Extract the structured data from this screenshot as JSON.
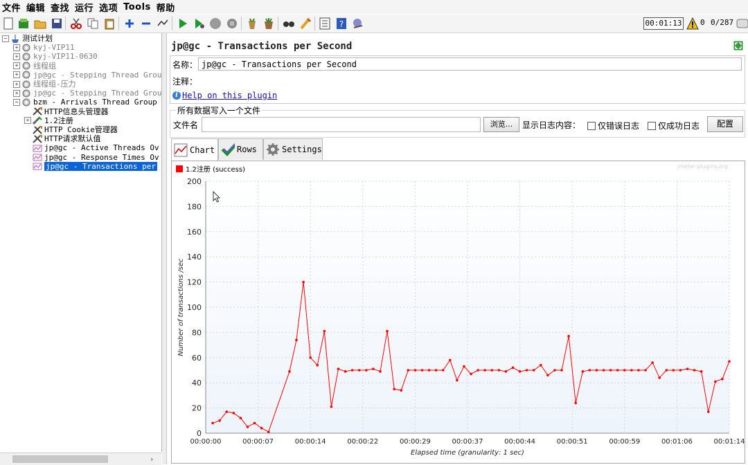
{
  "menu": [
    "文件",
    "编辑",
    "查找",
    "运行",
    "选项",
    "Tools",
    "帮助"
  ],
  "toolbar": {
    "icons": [
      "new-icon",
      "templates-icon",
      "open-icon",
      "save-icon",
      "cut-icon",
      "copy-icon",
      "paste-icon",
      "expand-icon",
      "collapse-icon",
      "toggle-icon",
      "start-icon",
      "start-no-pause-icon",
      "stop-icon",
      "shutdown-icon",
      "clear-icon",
      "clear-all-icon",
      "search-icon",
      "reset-search-icon",
      "function-helper-icon",
      "help-icon",
      "remote-icon"
    ],
    "timer": "00:01:13",
    "warnings": "0",
    "threads": "0/287"
  },
  "tree": [
    {
      "label": "测试计划",
      "depth": 0,
      "icon": "test-plan-icon",
      "expander": "−",
      "state": "normal"
    },
    {
      "label": "kyj-VIP11",
      "depth": 1,
      "icon": "thread-group-icon",
      "expander": "+",
      "state": "disabled"
    },
    {
      "label": "kyj-VIP11-0630",
      "depth": 1,
      "icon": "thread-group-icon",
      "expander": "+",
      "state": "disabled"
    },
    {
      "label": "线程组",
      "depth": 1,
      "icon": "thread-group-icon",
      "expander": "+",
      "state": "disabled"
    },
    {
      "label": "jp@gc - Stepping Thread Grou",
      "depth": 1,
      "icon": "thread-group-icon",
      "expander": "+",
      "state": "disabled"
    },
    {
      "label": "线程组-压力",
      "depth": 1,
      "icon": "thread-group-icon",
      "expander": "+",
      "state": "disabled"
    },
    {
      "label": "jp@gc - Stepping Thread Grou",
      "depth": 1,
      "icon": "thread-group-icon",
      "expander": "+",
      "state": "disabled"
    },
    {
      "label": "bzm - Arrivals Thread Group",
      "depth": 1,
      "icon": "thread-group-icon",
      "expander": "−",
      "state": "normal"
    },
    {
      "label": "HTTP信息头管理器",
      "depth": 2,
      "icon": "config-element-icon",
      "expander": "",
      "state": "normal"
    },
    {
      "label": "1.2注册",
      "depth": 2,
      "icon": "sampler-icon",
      "expander": "+",
      "state": "normal"
    },
    {
      "label": "HTTP Cookie管理器",
      "depth": 2,
      "icon": "config-element-icon",
      "expander": "",
      "state": "normal"
    },
    {
      "label": "HTTP请求默认值",
      "depth": 2,
      "icon": "config-element-icon",
      "expander": "",
      "state": "normal"
    },
    {
      "label": "jp@gc - Active Threads Ov",
      "depth": 2,
      "icon": "listener-icon",
      "expander": "",
      "state": "normal"
    },
    {
      "label": "jp@gc - Response Times Ov",
      "depth": 2,
      "icon": "listener-icon",
      "expander": "",
      "state": "normal"
    },
    {
      "label": "jp@gc - Transactions per",
      "depth": 2,
      "icon": "listener-icon",
      "expander": "",
      "state": "selected"
    }
  ],
  "panel": {
    "title": "jp@gc - Transactions per Second",
    "name_label": "名称：",
    "name_value": "jp@gc - Transactions per Second",
    "comment_label": "注释：",
    "help_link": "Help on this plugin"
  },
  "file_section": {
    "legend": "所有数据写入一个文件",
    "file_label": "文件名",
    "browse_button": "浏览...",
    "log_label": "显示日志内容：",
    "errors_only": "仅错误日志",
    "success_only": "仅成功日志",
    "config_button": "配置"
  },
  "tabs": [
    {
      "label": "Chart",
      "icon": "chart-tab-icon",
      "active": true
    },
    {
      "label": "Rows",
      "icon": "checkmark-icon",
      "active": false
    },
    {
      "label": "Settings",
      "icon": "gear-icon",
      "active": false
    }
  ],
  "chart_data": {
    "type": "line",
    "title": "",
    "xlabel": "Elapsed time (granularity: 1 sec)",
    "ylabel": "Number of transactions /sec",
    "ylim": [
      0,
      200
    ],
    "yticks": [
      0,
      20,
      40,
      60,
      80,
      100,
      120,
      140,
      160,
      180,
      200
    ],
    "xticks": [
      "00:00:00",
      "00:00:07",
      "00:00:14",
      "00:00:22",
      "00:00:29",
      "00:00:37",
      "00:00:44",
      "00:00:51",
      "00:00:59",
      "00:01:06",
      "00:01:14"
    ],
    "watermark": "jmeter-plugins.org",
    "grid": true,
    "legend_position": "top-left",
    "series": [
      {
        "name": "1.2注册 (success)",
        "color": "#ff0000",
        "x": [
          1,
          2,
          3,
          4,
          5,
          6,
          7,
          8,
          9,
          12,
          13,
          14,
          15,
          16,
          17,
          18,
          19,
          20,
          21,
          22,
          23,
          24,
          25,
          26,
          27,
          28,
          29,
          30,
          31,
          32,
          33,
          34,
          35,
          36,
          37,
          38,
          39,
          40,
          41,
          42,
          43,
          44,
          45,
          46,
          47,
          48,
          49,
          50,
          51,
          52,
          53,
          54,
          55,
          56,
          57,
          58,
          59,
          60,
          61,
          62,
          63,
          64,
          65,
          66,
          67,
          68,
          69,
          70,
          71,
          72,
          73,
          74,
          75
        ],
        "values": [
          8,
          10,
          17,
          16,
          12,
          5,
          8,
          4,
          1,
          49,
          74,
          120,
          60,
          54,
          81,
          21,
          51,
          49,
          50,
          50,
          50,
          51,
          49,
          81,
          35,
          34,
          50,
          50,
          50,
          50,
          50,
          50,
          58,
          42,
          53,
          47,
          50,
          50,
          50,
          50,
          49,
          52,
          49,
          50,
          50,
          54,
          46,
          50,
          50,
          77,
          24,
          49,
          50,
          50,
          50,
          50,
          50,
          50,
          50,
          50,
          50,
          56,
          44,
          50,
          50,
          50,
          51,
          50,
          49,
          17,
          41,
          43,
          57
        ]
      }
    ]
  }
}
